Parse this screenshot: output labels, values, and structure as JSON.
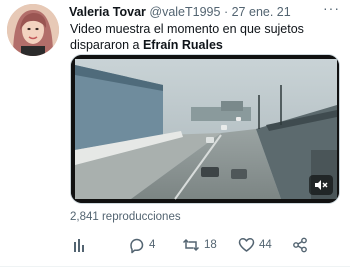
{
  "tweet": {
    "author_name": "Valeria Tovar",
    "author_handle": "@valeT1995",
    "separator": "·",
    "date": "27 ene. 21",
    "text_line1": "Video muestra el momento en que sujetos",
    "text_line2_prefix": "dispararon a ",
    "text_bold": "Efraín Ruales",
    "views": "2,841 reproducciones",
    "more_label": "···"
  },
  "actions": {
    "analytics_icon": "bar-chart-icon",
    "reply_count": "4",
    "retweet_count": "18",
    "like_count": "44",
    "share_icon": "share-icon"
  },
  "colors": {
    "text": "#0f1419",
    "secondary": "#536471",
    "border": "#cfd9de"
  }
}
